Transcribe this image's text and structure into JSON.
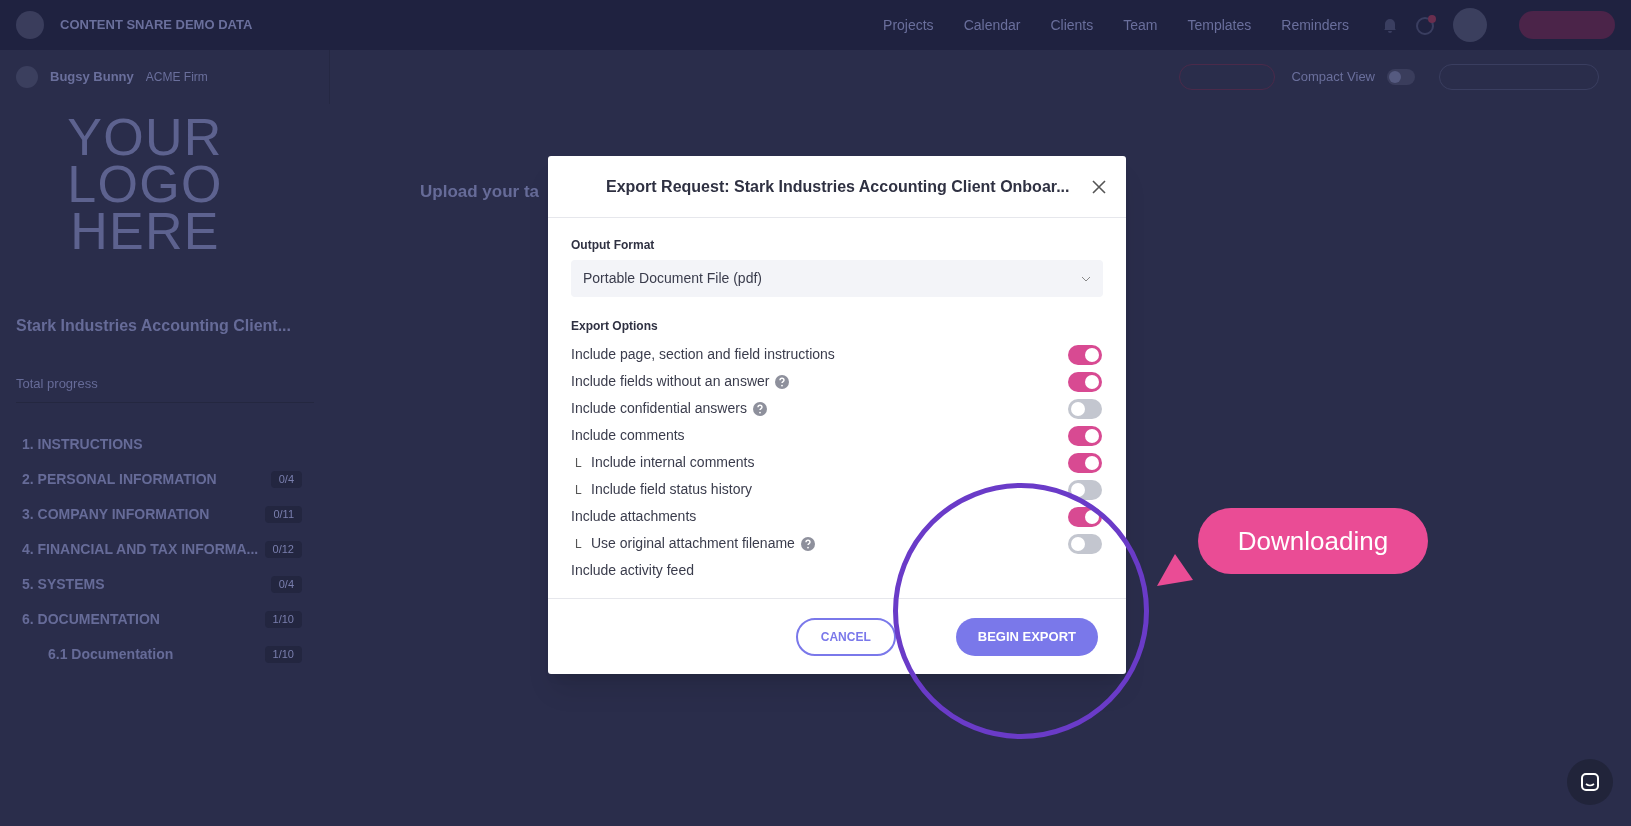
{
  "top_bar": {
    "brand": "CONTENT SNARE DEMO DATA",
    "nav": [
      "Projects",
      "Calendar",
      "Clients",
      "Team",
      "Templates",
      "Reminders"
    ]
  },
  "sub_bar": {
    "user": "Bugsy Bunny",
    "firm": "ACME Firm",
    "view_toggle": "Compact View",
    "compact_view_on": false
  },
  "sidebar": {
    "logo_lines": [
      "YOUR",
      "LOGO",
      "HERE"
    ],
    "title": "Stark Industries Accounting Client...",
    "progress_label": "Total progress",
    "sections": [
      {
        "label": "1. INSTRUCTIONS"
      },
      {
        "label": "2. PERSONAL INFORMATION",
        "count": "0/4"
      },
      {
        "label": "3. COMPANY INFORMATION",
        "count": "0/11"
      },
      {
        "label": "4. FINANCIAL AND TAX INFORMA...",
        "count": "0/12"
      },
      {
        "label": "5. SYSTEMS",
        "count": "0/4"
      },
      {
        "label": "6. DOCUMENTATION",
        "count": "1/10",
        "children": [
          {
            "label": "6.1 Documentation",
            "count": "1/10"
          }
        ]
      }
    ]
  },
  "main": {
    "heading": "Upload your ta"
  },
  "dialog": {
    "title": "Export Request: Stark Industries Accounting Client Onboar...",
    "format_label": "Output Format",
    "format_value": "Portable Document File (pdf)",
    "options_label": "Export Options",
    "options": [
      {
        "kind": "toggle",
        "label": "Include page, section and field instructions",
        "help": false,
        "on": true
      },
      {
        "kind": "toggle",
        "label": "Include fields without an answer",
        "help": true,
        "on": true
      },
      {
        "kind": "toggle",
        "label": "Include confidential answers",
        "help": true,
        "on": false
      },
      {
        "kind": "toggle",
        "label": "Include comments",
        "help": false,
        "on": true
      },
      {
        "kind": "toggle",
        "marker": "L",
        "label": "Include internal comments",
        "help": false,
        "on": true
      },
      {
        "kind": "toggle",
        "marker": "L",
        "label": "Include field status history",
        "help": false,
        "on": false
      },
      {
        "kind": "toggle",
        "label": "Include attachments",
        "help": false,
        "on": true
      },
      {
        "kind": "toggle",
        "marker": "L",
        "label": "Use original attachment filename",
        "help": true,
        "on": false
      },
      {
        "kind": "plain",
        "label": "Include activity feed",
        "help": false
      }
    ],
    "buttons": [
      {
        "kind": "secondary",
        "label": "CANCEL"
      },
      {
        "kind": "primary",
        "label": "BEGIN EXPORT"
      }
    ]
  },
  "callout": {
    "text": "Downloading"
  }
}
